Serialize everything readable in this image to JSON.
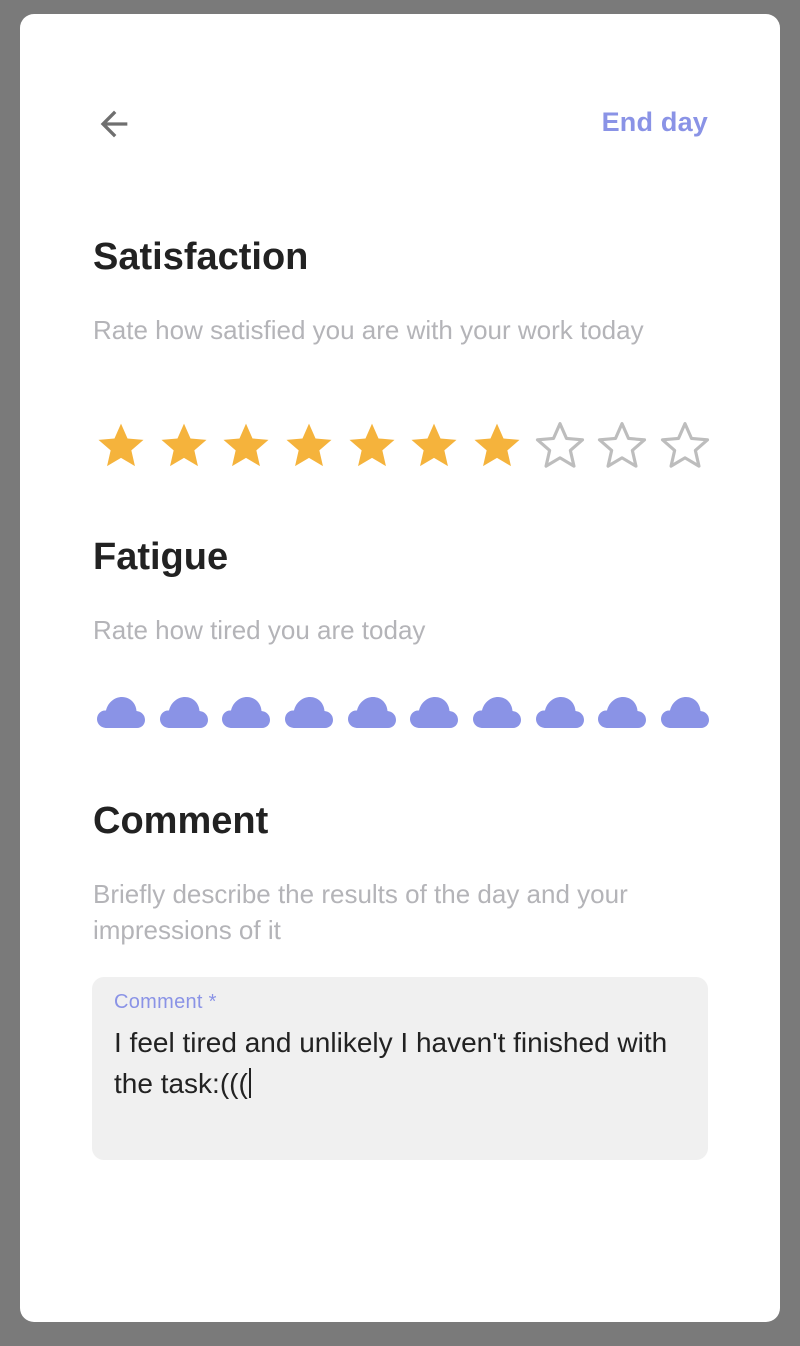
{
  "header": {
    "back_icon": "arrow-left-icon",
    "end_day_label": "End day"
  },
  "satisfaction": {
    "title": "Satisfaction",
    "description": "Rate how satisfied you are with your work today",
    "max": 10,
    "value": 7,
    "filled_color": "#f5b33c",
    "empty_color": "#bdbdbd",
    "icon": "star-icon"
  },
  "fatigue": {
    "title": "Fatigue",
    "description": "Rate how tired you are today",
    "max": 10,
    "value": 10,
    "filled_color": "#8a93e6",
    "icon": "cloud-icon"
  },
  "comment": {
    "title": "Comment",
    "description": "Briefly describe the results of the day and your impressions of it",
    "field_label": "Comment *",
    "value": "I feel tired and unlikely I haven't finished with the task:((("
  },
  "colors": {
    "accent": "#8a93e6",
    "star": "#f5b33c"
  }
}
